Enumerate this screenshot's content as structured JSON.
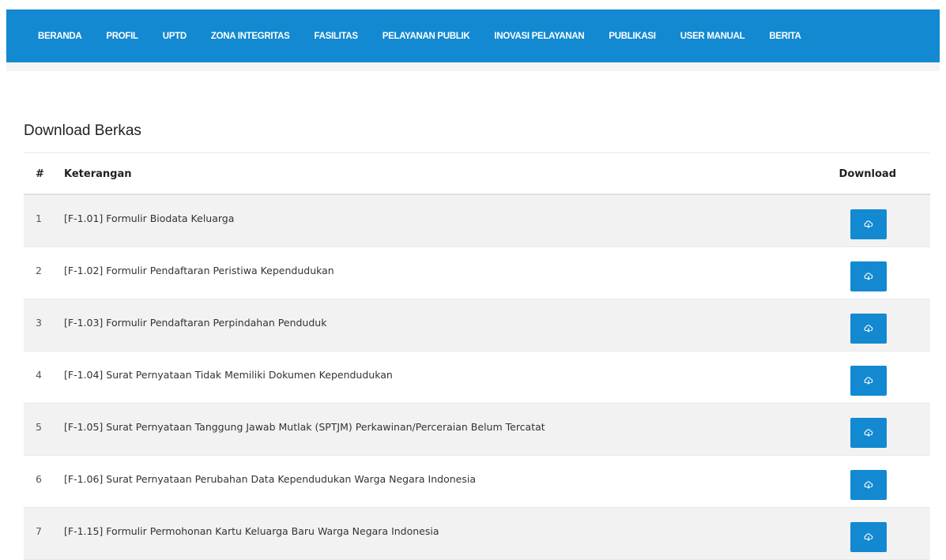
{
  "nav": {
    "items": [
      "BERANDA",
      "PROFIL",
      "UPTD",
      "ZONA INTEGRITAS",
      "FASILITAS",
      "PELAYANAN PUBLIK",
      "INOVASI PELAYANAN",
      "PUBLIKASI",
      "USER MANUAL",
      "BERITA"
    ]
  },
  "page": {
    "title": "Download Berkas"
  },
  "table": {
    "headers": {
      "num": "#",
      "keterangan": "Keterangan",
      "download": "Download"
    },
    "download_icon": "cloud-download-icon",
    "rows": [
      {
        "no": "1",
        "keterangan": "[F-1.01] Formulir Biodata Keluarga"
      },
      {
        "no": "2",
        "keterangan": "[F-1.02] Formulir Pendaftaran Peristiwa Kependudukan"
      },
      {
        "no": "3",
        "keterangan": "[F-1.03] Formulir Pendaftaran Perpindahan Penduduk"
      },
      {
        "no": "4",
        "keterangan": "[F-1.04] Surat Pernyataan Tidak Memiliki Dokumen Kependudukan"
      },
      {
        "no": "5",
        "keterangan": "[F-1.05] Surat Pernyataan Tanggung Jawab Mutlak (SPTJM) Perkawinan/Perceraian Belum Tercatat"
      },
      {
        "no": "6",
        "keterangan": "[F-1.06] Surat Pernyataan Perubahan Data Kependudukan Warga Negara Indonesia"
      },
      {
        "no": "7",
        "keterangan": "[F-1.15] Formulir Permohonan Kartu Keluarga Baru Warga Negara Indonesia"
      }
    ]
  },
  "colors": {
    "primary": "#1389d1",
    "row_stripe": "#f2f2f2"
  }
}
